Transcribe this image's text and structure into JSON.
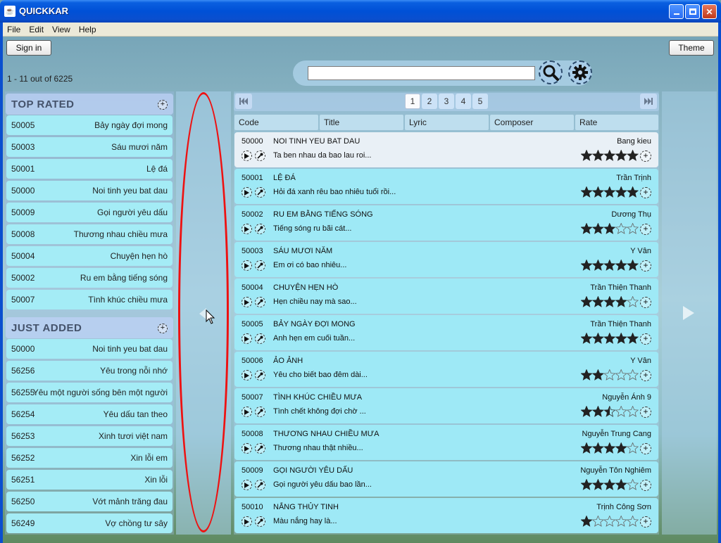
{
  "window": {
    "title": "QUICKKAR"
  },
  "menu": [
    "File",
    "Edit",
    "View",
    "Help"
  ],
  "header": {
    "sign_in_label": "Sign in",
    "theme_label": "Theme",
    "result_count": "1 - 11 out of 6225",
    "search_value": "",
    "search_icon": "search-icon",
    "settings_icon": "gear-icon"
  },
  "top_rated": {
    "title": "TOP RATED",
    "items": [
      {
        "code": "50005",
        "title": "Bảy ngày đợi mong"
      },
      {
        "code": "50003",
        "title": "Sáu mươi năm"
      },
      {
        "code": "50001",
        "title": "Lệ đá"
      },
      {
        "code": "50000",
        "title": "Noi tinh yeu bat dau"
      },
      {
        "code": "50009",
        "title": "Gọi người yêu dấu"
      },
      {
        "code": "50008",
        "title": "Thương nhau chiều mưa"
      },
      {
        "code": "50004",
        "title": "Chuyện hẹn hò"
      },
      {
        "code": "50002",
        "title": "Ru em bằng tiếng sóng"
      },
      {
        "code": "50007",
        "title": "Tình khúc chiều mưa"
      }
    ]
  },
  "just_added": {
    "title": "JUST ADDED",
    "items": [
      {
        "code": "50000",
        "title": "Noi tinh yeu bat dau"
      },
      {
        "code": "56256",
        "title": "Yêu trong nỗi nhớ"
      },
      {
        "code": "56255",
        "title": "Yêu một người sống bên một người"
      },
      {
        "code": "56254",
        "title": "Yêu dấu tan theo"
      },
      {
        "code": "56253",
        "title": "Xinh tươi việt nam"
      },
      {
        "code": "56252",
        "title": "Xin lỗi em"
      },
      {
        "code": "56251",
        "title": "Xin lỗi"
      },
      {
        "code": "56250",
        "title": "Vớt mảnh trăng đau"
      },
      {
        "code": "56249",
        "title": "Vợ chồng tư sây"
      }
    ]
  },
  "pagination": {
    "pages": [
      "1",
      "2",
      "3",
      "4",
      "5"
    ],
    "current": "1"
  },
  "columns": [
    "Code",
    "Title",
    "Lyric",
    "Composer",
    "Rate"
  ],
  "songs": [
    {
      "code": "50000",
      "title": "NOI TINH YEU BAT DAU",
      "composer": "Bang kieu",
      "lyric": "Ta ben nhau da bao lau roi...",
      "rating": 5
    },
    {
      "code": "50001",
      "title": "LỆ ĐÁ",
      "composer": "Trần Trịnh",
      "lyric": "Hỏi đá xanh rêu bao nhiêu tuổi rồi...",
      "rating": 5
    },
    {
      "code": "50002",
      "title": "RU EM BẰNG TIẾNG SÓNG",
      "composer": "Dương Thụ",
      "lyric": "Tiếng sóng ru bãi cát...",
      "rating": 3
    },
    {
      "code": "50003",
      "title": "SÁU MƯƠI NĂM",
      "composer": "Y Vân",
      "lyric": "Em ơi có bao nhiêu...",
      "rating": 5
    },
    {
      "code": "50004",
      "title": "CHUYỆN HẸN HÒ",
      "composer": "Trần Thiện Thanh",
      "lyric": "Hẹn chiều nay mà sao...",
      "rating": 4
    },
    {
      "code": "50005",
      "title": "BẢY NGÀY ĐỢI MONG",
      "composer": "Trần Thiện Thanh",
      "lyric": "Anh hẹn em cuối tuần...",
      "rating": 5
    },
    {
      "code": "50006",
      "title": "ẢO ẢNH",
      "composer": "Y Vân",
      "lyric": "Yêu cho biết bao đêm dài...",
      "rating": 2
    },
    {
      "code": "50007",
      "title": "TÌNH KHÚC CHIỀU MƯA",
      "composer": "Nguyễn Ánh 9",
      "lyric": "Tình chết không đợi chờ ...",
      "rating": 2.5
    },
    {
      "code": "50008",
      "title": "THƯƠNG NHAU CHIỀU MƯA",
      "composer": "Nguyễn Trung Cang",
      "lyric": "Thương nhau thật nhiều...",
      "rating": 4
    },
    {
      "code": "50009",
      "title": "GỌI NGƯỜI YÊU DẤU",
      "composer": "Nguyễn Tôn Nghiêm",
      "lyric": "Gọi người yêu dấu bao lần...",
      "rating": 4
    },
    {
      "code": "50010",
      "title": "NẮNG THỦY TINH",
      "composer": "Trịnh Công Sơn",
      "lyric": "Màu nắng hay là...",
      "rating": 1
    }
  ],
  "colors": {
    "row_bg": "#9ee9f6",
    "selected_row_bg": "#e9f0f6",
    "star": "#222222",
    "annotation": "#e11111"
  }
}
